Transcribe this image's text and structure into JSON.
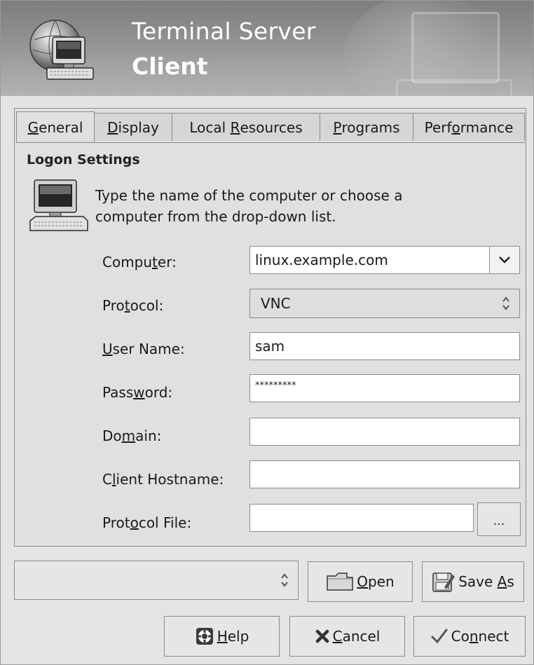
{
  "window": {
    "title_line1": "Terminal Server",
    "title_line2": "Client"
  },
  "tabs": [
    {
      "pre": "",
      "u": "G",
      "post": "eneral",
      "active": true
    },
    {
      "pre": "",
      "u": "D",
      "post": "isplay",
      "active": false
    },
    {
      "pre": "Local ",
      "u": "R",
      "post": "esources",
      "active": false
    },
    {
      "pre": "",
      "u": "P",
      "post": "rograms",
      "active": false
    },
    {
      "pre": "Perf",
      "u": "o",
      "post": "rmance",
      "active": false
    }
  ],
  "general": {
    "section_title": "Logon Settings",
    "info_line1": "Type the name of the computer or choose a",
    "info_line2": "computer from the drop-down list.",
    "fields": {
      "computer": {
        "label_pre": "Compu",
        "label_u": "t",
        "label_post": "er:",
        "value": "linux.example.com"
      },
      "protocol": {
        "label_pre": "Pro",
        "label_u": "t",
        "label_post": "ocol:",
        "value": "VNC"
      },
      "user_name": {
        "label_pre": "",
        "label_u": "U",
        "label_post": "ser Name:",
        "value": "sam"
      },
      "password": {
        "label_pre": "Pass",
        "label_u": "w",
        "label_post": "ord:",
        "value": "*********"
      },
      "domain": {
        "label_pre": "Do",
        "label_u": "m",
        "label_post": "ain:",
        "value": ""
      },
      "client_hostname": {
        "label_pre": "C",
        "label_u": "l",
        "label_post": "ient Hostname:",
        "value": ""
      },
      "protocol_file": {
        "label_pre": "Prot",
        "label_u": "o",
        "label_post": "col File:",
        "value": "",
        "browse": "..."
      }
    }
  },
  "bottom": {
    "profile_value": "",
    "open": {
      "pre": "",
      "u": "O",
      "post": "pen"
    },
    "save_as": {
      "pre": "Save ",
      "u": "A",
      "post": "s"
    },
    "help": {
      "pre": "",
      "u": "H",
      "post": "elp"
    },
    "cancel": {
      "pre": "",
      "u": "C",
      "post": "ancel"
    },
    "connect": {
      "pre": "Co",
      "u": "n",
      "post": "nect"
    }
  },
  "icons": {
    "banner": "terminal-computer-globe-icon",
    "info": "computer-icon",
    "open": "folder-icon",
    "save_as": "save-disk-icon",
    "help": "help-lifebuoy-icon",
    "cancel": "cancel-x-icon",
    "connect": "check-icon"
  }
}
